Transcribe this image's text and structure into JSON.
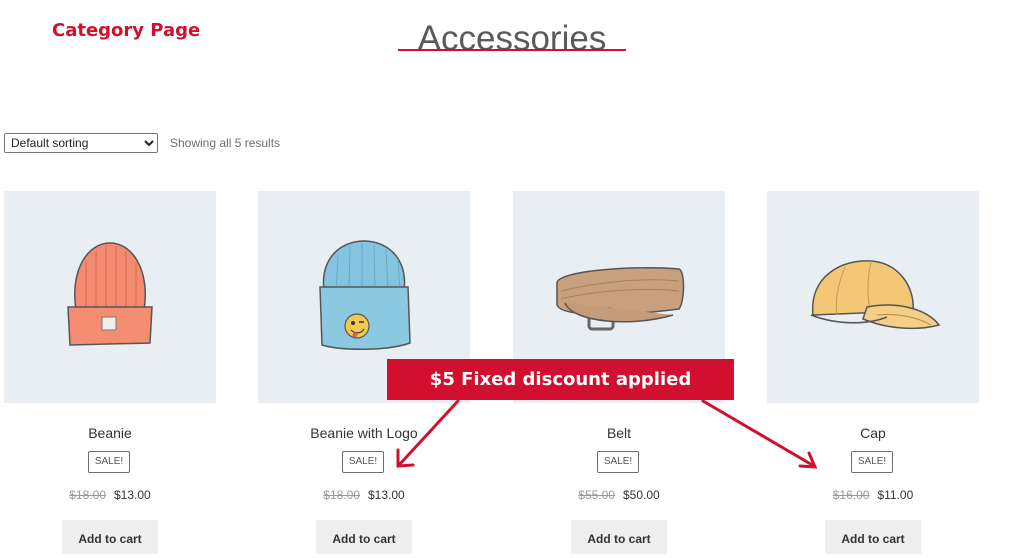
{
  "annotation": {
    "category_label": "Category Page",
    "banner_text": "$5 Fixed discount applied",
    "accent_color": "#d0102e"
  },
  "page": {
    "title": "Accessories"
  },
  "toolbar": {
    "sort_selected": "Default sorting",
    "result_count": "Showing all 5 results"
  },
  "products": [
    {
      "name": "Beanie",
      "badge": "SALE!",
      "old_price": "$18.00",
      "price": "$13.00",
      "button": "Add to cart",
      "image_icon": "beanie-icon"
    },
    {
      "name": "Beanie with Logo",
      "badge": "SALE!",
      "old_price": "$18.00",
      "price": "$13.00",
      "button": "Add to cart",
      "image_icon": "beanie-with-logo-icon"
    },
    {
      "name": "Belt",
      "badge": "SALE!",
      "old_price": "$55.00",
      "price": "$50.00",
      "button": "Add to cart",
      "image_icon": "belt-icon"
    },
    {
      "name": "Cap",
      "badge": "SALE!",
      "old_price": "$16.00",
      "price": "$11.00",
      "button": "Add to cart",
      "image_icon": "cap-icon"
    }
  ]
}
